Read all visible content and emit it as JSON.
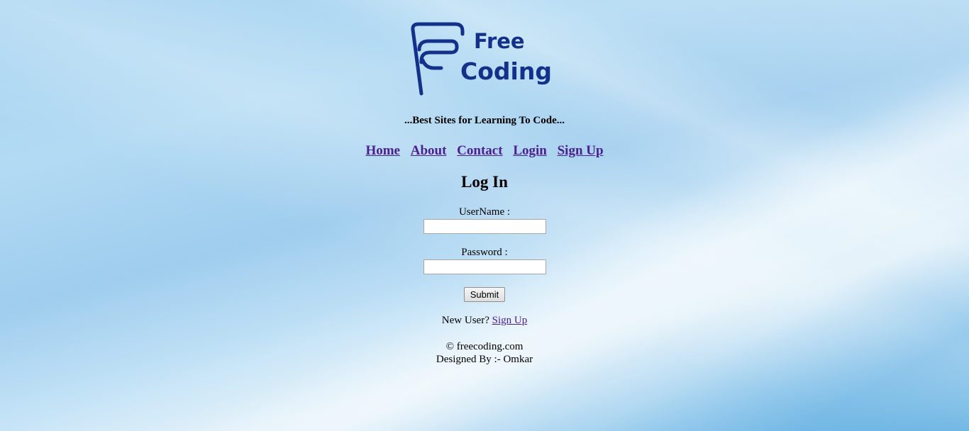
{
  "logo": {
    "line1": "Free",
    "line2": "Coding",
    "icon": "fc-logo-mark",
    "color": "#13318a"
  },
  "tagline": "...Best Sites for Learning To Code...",
  "nav": {
    "items": [
      {
        "label": "Home"
      },
      {
        "label": "About"
      },
      {
        "label": "Contact"
      },
      {
        "label": "Login"
      },
      {
        "label": "Sign Up"
      }
    ],
    "link_color": "#4b1e8f"
  },
  "login": {
    "title": "Log In",
    "username_label": "UserName :",
    "username_value": "",
    "password_label": "Password :",
    "password_value": "",
    "submit_label": "Submit",
    "new_user_text": "New User?",
    "signup_link": "Sign Up"
  },
  "footer": {
    "copyright": "© freecoding.com",
    "designed_by": "Designed By :- Omkar"
  }
}
